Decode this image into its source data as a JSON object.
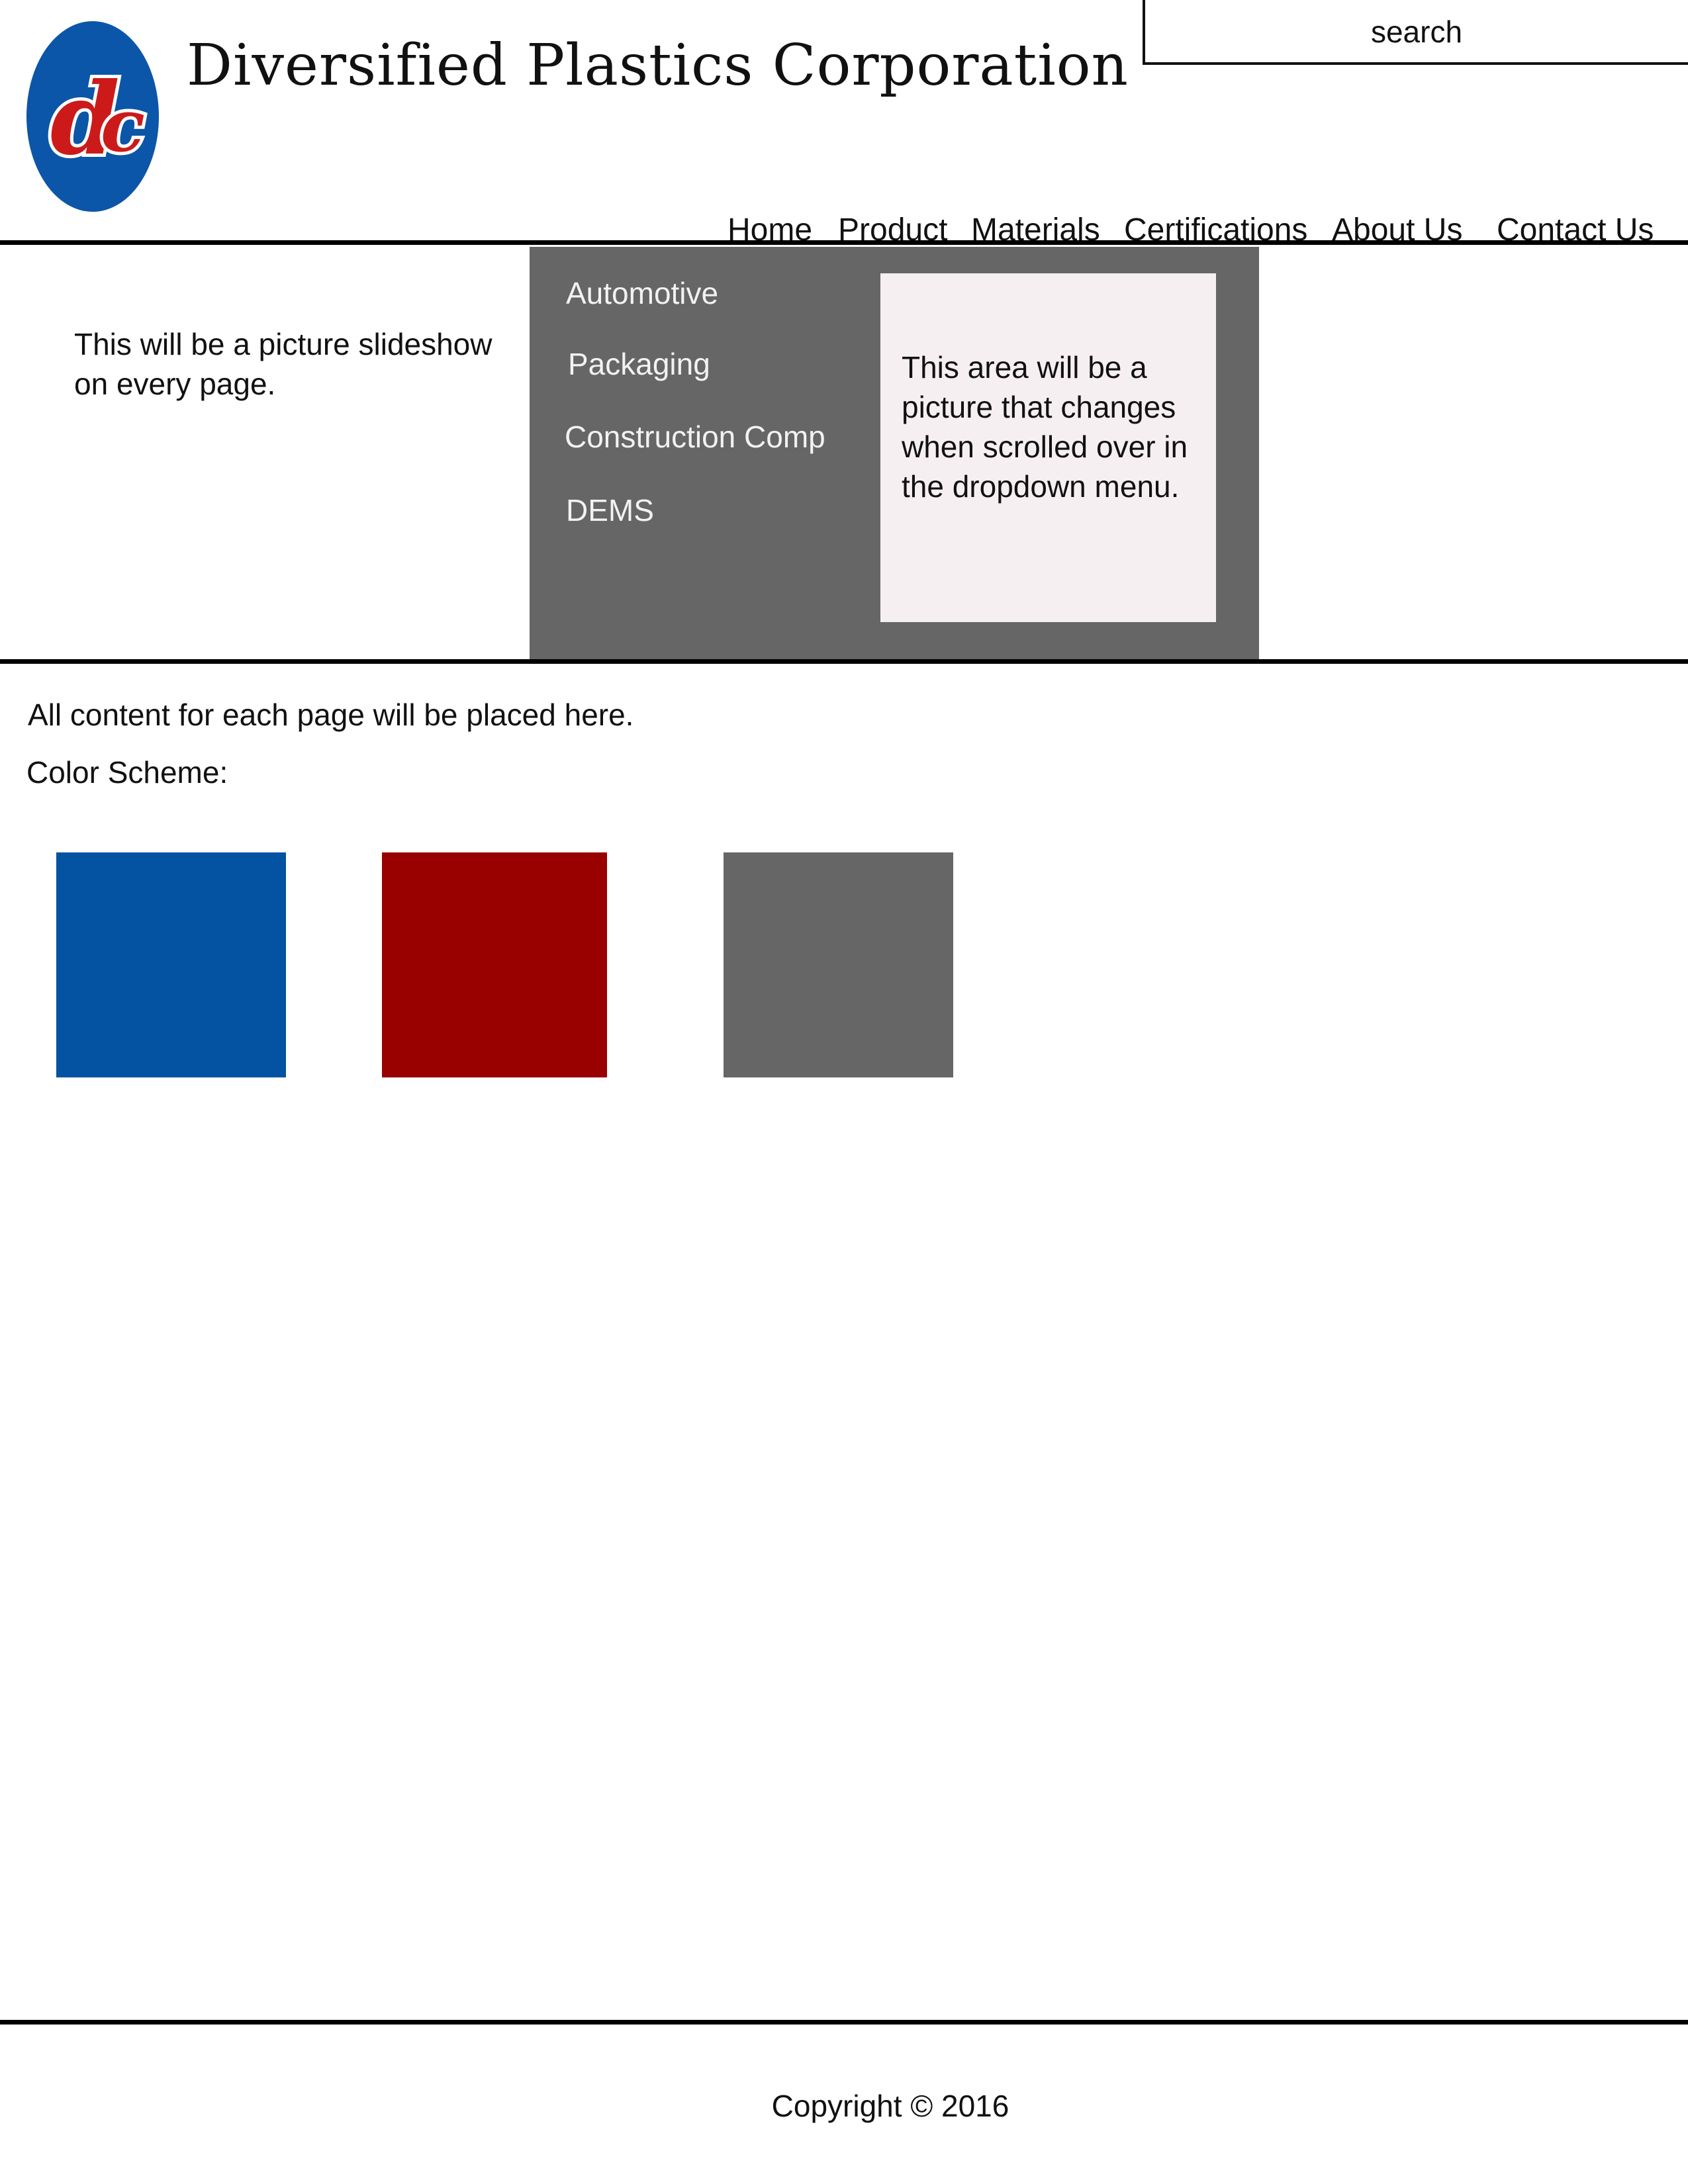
{
  "header": {
    "company_name": "Diversified Plastics Corporation",
    "logo": {
      "icon": "dpc-logo-icon",
      "oval_color": "#0b56a8",
      "letter_color": "#cc1a1a"
    },
    "search": {
      "placeholder": "search"
    }
  },
  "nav": {
    "items": [
      {
        "label": "Home"
      },
      {
        "label": "Product"
      },
      {
        "label": "Materials"
      },
      {
        "label": "Certifications"
      },
      {
        "label": "About Us"
      },
      {
        "label": "Contact Us"
      }
    ]
  },
  "slideshow": {
    "text": "This will be a picture slideshow on every page."
  },
  "dropdown": {
    "background_color": "#666666",
    "items": [
      {
        "label": "Automotive"
      },
      {
        "label": "Packaging"
      },
      {
        "label": "Construction Comp"
      },
      {
        "label": "DEMS"
      }
    ],
    "preview": {
      "text": "This area will be a picture that changes when scrolled over in the dropdown menu.",
      "background_color": "#f6eff1"
    }
  },
  "content": {
    "text": "All content for each page will be placed here.",
    "color_scheme_label": "Color Scheme:",
    "swatches": [
      {
        "color": "#0453a3"
      },
      {
        "color": "#990000"
      },
      {
        "color": "#666666"
      }
    ]
  },
  "footer": {
    "copyright": "Copyright © 2016"
  }
}
